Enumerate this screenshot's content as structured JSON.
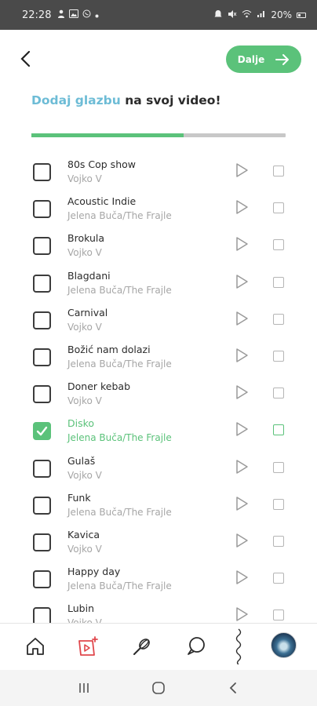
{
  "status": {
    "time": "22:28",
    "left_icons": [
      "person-icon",
      "image-icon",
      "viber-icon",
      "dot-icon"
    ],
    "right_icons": [
      "alarm-icon",
      "mute-icon",
      "wifi-icon",
      "signal-icon"
    ],
    "battery": "20%"
  },
  "header": {
    "next_label": "Dalje",
    "back_icon": "chevron-left-icon",
    "next_icon": "arrow-right-icon"
  },
  "title": {
    "accent": "Dodaj glazbu",
    "rest": " na svoj video!"
  },
  "progress": {
    "value": 0.6
  },
  "colors": {
    "accent_green": "#5bc27a",
    "accent_blue": "#6dbcd6"
  },
  "songs": [
    {
      "title": "80s Cop show",
      "artist": "Vojko V",
      "selected": false
    },
    {
      "title": "Acoustic Indie",
      "artist": "Jelena Buča/The Frajle",
      "selected": false
    },
    {
      "title": "Brokula",
      "artist": "Vojko V",
      "selected": false
    },
    {
      "title": "Blagdani",
      "artist": "Jelena Buča/The Frajle",
      "selected": false
    },
    {
      "title": "Carnival",
      "artist": "Vojko V",
      "selected": false
    },
    {
      "title": "Božić nam dolazi",
      "artist": "Jelena Buča/The Frajle",
      "selected": false
    },
    {
      "title": "Doner kebab",
      "artist": "Vojko V",
      "selected": false
    },
    {
      "title": "Disko",
      "artist": "Jelena Buča/The Frajle",
      "selected": true
    },
    {
      "title": "Gulaš",
      "artist": "Vojko V",
      "selected": false
    },
    {
      "title": "Funk",
      "artist": "Jelena Buča/The Frajle",
      "selected": false
    },
    {
      "title": "Kavica",
      "artist": "Vojko V",
      "selected": false
    },
    {
      "title": "Happy day",
      "artist": "Jelena Buča/The Frajle",
      "selected": false
    },
    {
      "title": "Lubin",
      "artist": "Vojko V",
      "selected": false
    }
  ],
  "bottom_nav": [
    "home-icon",
    "video-add-icon",
    "whisk-icon",
    "chat-icon",
    "squiggle-icon",
    "avatar"
  ],
  "system_nav": [
    "recents-icon",
    "home-circle-icon",
    "back-icon"
  ]
}
